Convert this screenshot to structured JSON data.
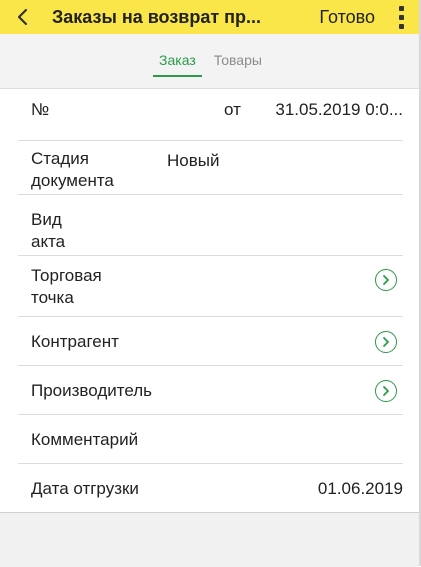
{
  "header": {
    "title": "Заказы на возврат пр...",
    "done_label": "Готово"
  },
  "tabs": [
    {
      "label": "Заказ",
      "active": true
    },
    {
      "label": "Товары",
      "active": false
    }
  ],
  "form": {
    "number_label": "№",
    "date_prefix": "от",
    "date_value": "31.05.2019 0:0...",
    "stage_label_line1": "Стадия",
    "stage_label_line2": "документа",
    "stage_value": "Новый",
    "act_label_line1": "Вид",
    "act_label_line2": "акта",
    "outlet_label_line1": "Торговая",
    "outlet_label_line2": "точка",
    "counterparty_label": "Контрагент",
    "manufacturer_label": "Производитель",
    "comment_label": "Комментарий",
    "ship_date_label": "Дата отгрузки",
    "ship_date_value": "01.06.2019"
  },
  "colors": {
    "header_bg": "#fbe64a",
    "accent": "#2b9a4a"
  },
  "icons": {
    "back": "chevron-left-icon",
    "menu": "more-vertical-icon",
    "row_action": "circle-chevron-right-icon"
  }
}
